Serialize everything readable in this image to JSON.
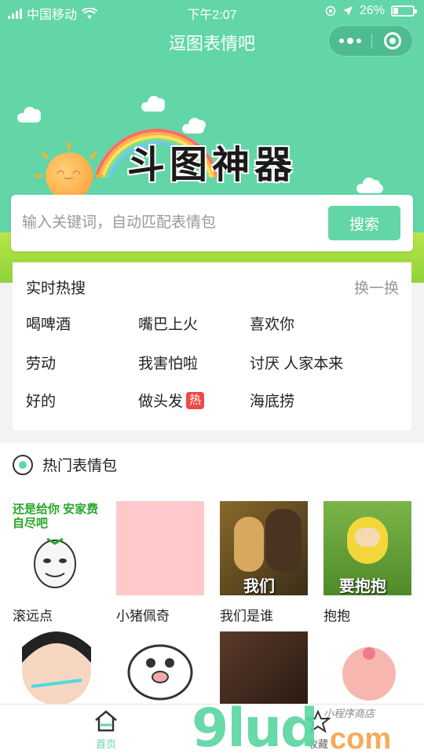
{
  "status_bar": {
    "carrier": "中国移动",
    "time": "下午2:07",
    "battery": "26%",
    "battery_level": 0.26
  },
  "nav": {
    "title": "逗图表情吧"
  },
  "banner": {
    "logo_text": "斗图神器"
  },
  "search": {
    "placeholder": "输入关键词，自动匹配表情包",
    "button_label": "搜索"
  },
  "hot_search": {
    "title": "实时热搜",
    "refresh_label": "换一换",
    "items": [
      {
        "label": "喝啤酒",
        "badge": ""
      },
      {
        "label": "嘴巴上火",
        "badge": ""
      },
      {
        "label": "喜欢你",
        "badge": ""
      },
      {
        "label": "劳动",
        "badge": ""
      },
      {
        "label": "我害怕啦",
        "badge": ""
      },
      {
        "label": "讨厌 人家本来",
        "badge": ""
      },
      {
        "label": "好的",
        "badge": ""
      },
      {
        "label": "做头发",
        "badge": "热"
      },
      {
        "label": "海底捞",
        "badge": ""
      }
    ]
  },
  "hot_memes": {
    "title": "热门表情包",
    "items": [
      {
        "label": "滚远点",
        "caption": "还是给你 安家费 自尽吧"
      },
      {
        "label": "小猪佩奇",
        "caption": ""
      },
      {
        "label": "我们是谁",
        "caption": "我们"
      },
      {
        "label": "抱抱",
        "caption": "要抱抱"
      },
      {
        "label": "",
        "caption": ""
      },
      {
        "label": "",
        "caption": ""
      },
      {
        "label": "",
        "caption": ""
      },
      {
        "label": "",
        "caption": ""
      }
    ]
  },
  "tabbar": {
    "home_label": "首页",
    "fav_label": "收藏"
  },
  "watermark": {
    "brand": "9lud",
    "suffix": "com",
    "sub": "小程序商店"
  },
  "colors": {
    "accent": "#62d6a6",
    "badge": "#f04848"
  }
}
